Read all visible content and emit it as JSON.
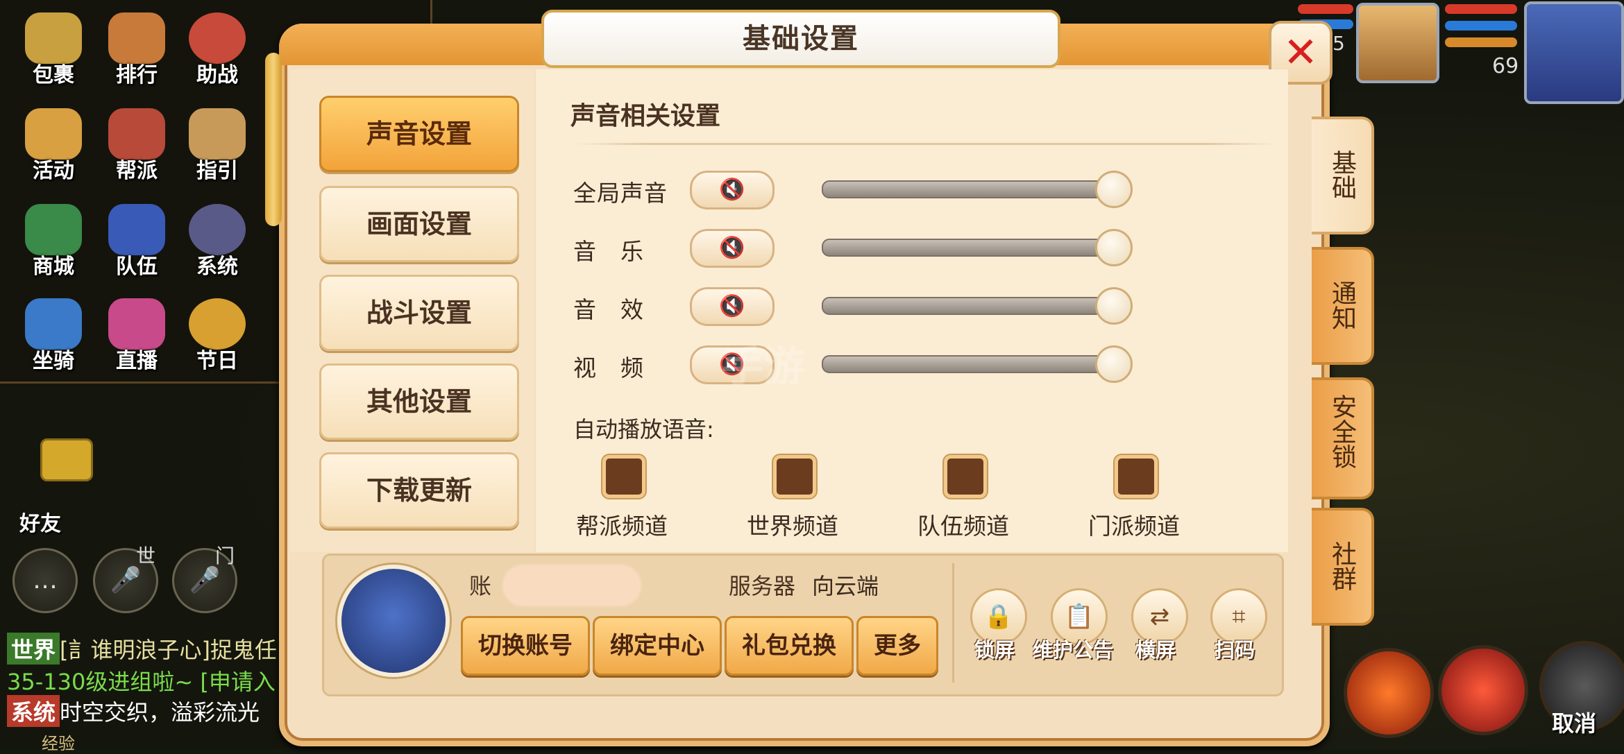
{
  "hud": {
    "menu_items": [
      {
        "label": "包裹",
        "color": "#c8a040"
      },
      {
        "label": "排行",
        "color": "#c87a3a"
      },
      {
        "label": "助战",
        "color": "#c84a3a"
      },
      {
        "label": "活动",
        "color": "#d8a040"
      },
      {
        "label": "帮派",
        "color": "#b84a3a"
      },
      {
        "label": "指引",
        "color": "#c89a5a"
      },
      {
        "label": "商城",
        "color": "#3a8a4a"
      },
      {
        "label": "队伍",
        "color": "#3a5ab8"
      },
      {
        "label": "系统",
        "color": "#5a5a88"
      },
      {
        "label": "坐骑",
        "color": "#3a7ac8"
      },
      {
        "label": "直播",
        "color": "#c84a8a"
      },
      {
        "label": "节日",
        "color": "#d8a030"
      }
    ],
    "friend_label": "好友",
    "voice_world": "世",
    "voice_sect": "门",
    "chat_lines": [
      {
        "tag": "世界",
        "tag_color": "#3a7a2a",
        "text": "[訁谁明浪子心]捉鬼任",
        "text_color": "#e8e0a0"
      },
      {
        "tag": "",
        "tag_color": "",
        "text": "35-130级进组啦~ [申请入",
        "text_color": "#7adc4a"
      },
      {
        "tag": "系统",
        "tag_color": "#b83a2a",
        "text": "时空交织，溢彩流光",
        "text_color": "#ffffff"
      }
    ],
    "bottom_partial": "经验",
    "level_partner": "5",
    "level_player": "69",
    "cancel_label": "取消"
  },
  "dialog": {
    "title": "基础设置",
    "left_tabs": [
      {
        "label": "声音设置",
        "active": true
      },
      {
        "label": "画面设置",
        "active": false
      },
      {
        "label": "战斗设置",
        "active": false
      },
      {
        "label": "其他设置",
        "active": false
      },
      {
        "label": "下载更新",
        "active": false
      }
    ],
    "section_title": "声音相关设置",
    "sound_rows": [
      {
        "label": "全局声音",
        "volume": 1.0
      },
      {
        "label": "音　乐",
        "volume": 1.0
      },
      {
        "label": "音　效",
        "volume": 1.0
      },
      {
        "label": "视　频",
        "volume": 1.0
      }
    ],
    "auto_voice_label": "自动播放语音:",
    "channels": [
      "帮派频道",
      "世界频道",
      "队伍频道",
      "门派频道"
    ],
    "account_label": "账",
    "server_label": "服务器",
    "server_value": "向云端",
    "account_buttons": [
      "切换账号",
      "绑定中心",
      "礼包兑换",
      "更多"
    ],
    "circle_buttons": [
      {
        "label": "锁屏",
        "icon": "lock-icon",
        "glyph": "🔒"
      },
      {
        "label": "维护公告",
        "icon": "clipboard-icon",
        "glyph": "📋"
      },
      {
        "label": "横屏",
        "icon": "rotate-screen-icon",
        "glyph": "⇄"
      },
      {
        "label": "扫码",
        "icon": "scan-icon",
        "glyph": "⌗"
      }
    ],
    "side_tabs": [
      {
        "label": "基础",
        "active": true
      },
      {
        "label": "通知",
        "active": false
      },
      {
        "label": "安全锁",
        "active": false
      },
      {
        "label": "社群",
        "active": false
      }
    ],
    "watermark": "手游"
  }
}
